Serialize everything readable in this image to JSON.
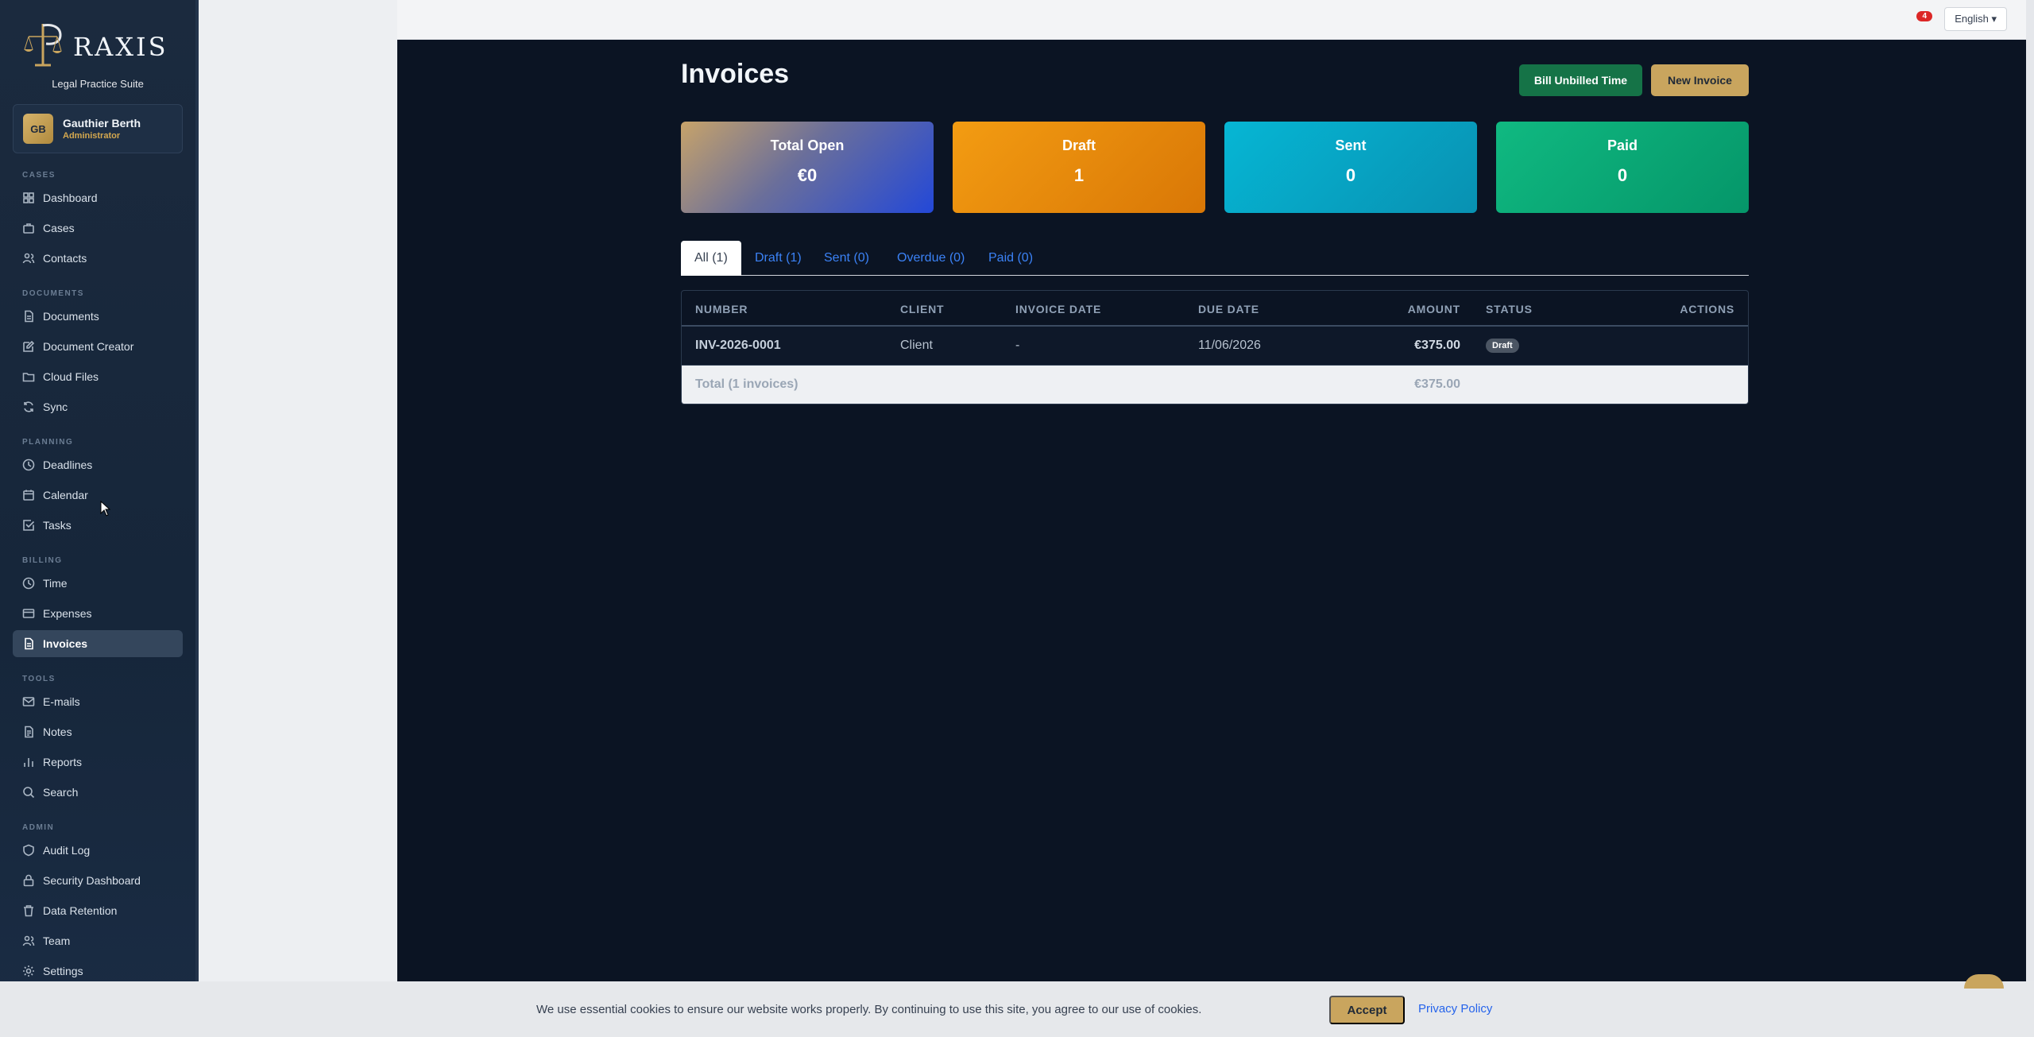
{
  "brand": {
    "name": "RAXIS",
    "tagline": "Legal Practice Suite"
  },
  "user": {
    "initials": "GB",
    "name": "Gauthier Berth",
    "role": "Administrator"
  },
  "sidebar": {
    "sections": [
      {
        "label": "CASES",
        "items": [
          {
            "label": "Dashboard",
            "icon": "grid-icon"
          },
          {
            "label": "Cases",
            "icon": "briefcase-icon"
          },
          {
            "label": "Contacts",
            "icon": "users-icon"
          }
        ]
      },
      {
        "label": "DOCUMENTS",
        "items": [
          {
            "label": "Documents",
            "icon": "file-icon"
          },
          {
            "label": "Document Creator",
            "icon": "edit-icon"
          },
          {
            "label": "Cloud Files",
            "icon": "folder-icon"
          },
          {
            "label": "Sync",
            "icon": "refresh-icon"
          }
        ]
      },
      {
        "label": "PLANNING",
        "items": [
          {
            "label": "Deadlines",
            "icon": "clock-icon"
          },
          {
            "label": "Calendar",
            "icon": "calendar-icon"
          },
          {
            "label": "Tasks",
            "icon": "checkbox-icon"
          }
        ]
      },
      {
        "label": "BILLING",
        "items": [
          {
            "label": "Time",
            "icon": "clock-icon"
          },
          {
            "label": "Expenses",
            "icon": "credit-card-icon"
          },
          {
            "label": "Invoices",
            "icon": "invoice-icon",
            "active": true
          }
        ]
      },
      {
        "label": "TOOLS",
        "items": [
          {
            "label": "E-mails",
            "icon": "mail-icon"
          },
          {
            "label": "Notes",
            "icon": "note-icon"
          },
          {
            "label": "Reports",
            "icon": "bar-chart-icon"
          },
          {
            "label": "Search",
            "icon": "search-icon"
          }
        ]
      },
      {
        "label": "ADMIN",
        "items": [
          {
            "label": "Audit Log",
            "icon": "shield-icon"
          },
          {
            "label": "Security Dashboard",
            "icon": "lock-icon"
          },
          {
            "label": "Data Retention",
            "icon": "trash-icon"
          },
          {
            "label": "Team",
            "icon": "users-icon"
          },
          {
            "label": "Settings",
            "icon": "gear-icon"
          }
        ]
      }
    ]
  },
  "topbar": {
    "notification_count": "4",
    "language": "English ▾"
  },
  "page": {
    "title": "Invoices",
    "bill_button": "Bill Unbilled Time",
    "new_button": "New Invoice"
  },
  "stats": {
    "total_open": {
      "label": "Total Open",
      "value": "€0"
    },
    "draft": {
      "label": "Draft",
      "value": "1"
    },
    "sent": {
      "label": "Sent",
      "value": "0"
    },
    "paid": {
      "label": "Paid",
      "value": "0"
    }
  },
  "tabs": [
    {
      "label": "All (1)",
      "active": true
    },
    {
      "label": "Draft (1)"
    },
    {
      "label": "Sent (0)"
    },
    {
      "label": "Overdue (0)"
    },
    {
      "label": "Paid (0)"
    }
  ],
  "table": {
    "headers": {
      "number": "NUMBER",
      "client": "CLIENT",
      "invoice_date": "INVOICE DATE",
      "due_date": "DUE DATE",
      "amount": "AMOUNT",
      "status": "STATUS",
      "actions": "ACTIONS"
    },
    "rows": [
      {
        "number": "INV-2026-0001",
        "client": "Client",
        "invoice_date": "-",
        "due_date": "11/06/2026",
        "amount": "€375.00",
        "status": "Draft"
      }
    ],
    "footer": {
      "label": "Total (1 invoices)",
      "amount": "€375.00"
    }
  },
  "cookie": {
    "text": "We use essential cookies to ensure our website works properly. By continuing to use this site, you agree to our use of cookies.",
    "accept": "Accept",
    "privacy": "Privacy Policy"
  },
  "colors": {
    "accent_gold": "#c9a55e",
    "bill_green": "#157347",
    "link_blue": "#3b82f6"
  }
}
